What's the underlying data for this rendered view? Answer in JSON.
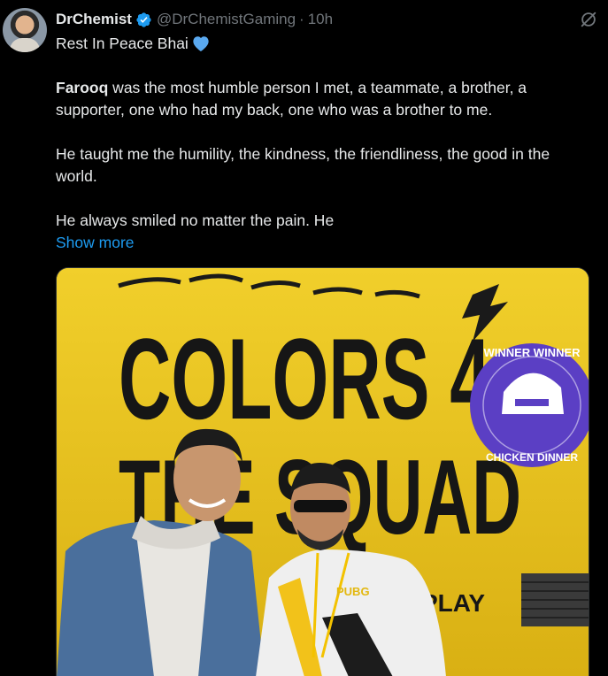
{
  "tweet": {
    "display_name": "DrChemist",
    "handle": "@DrChemistGaming",
    "separator": "·",
    "time": "10h",
    "lines": {
      "l1": "Rest In Peace Bhai",
      "l2_bold": "Farooq",
      "l2_rest": " was the most humble person I met, a teammate, a brother, a",
      "l3": "supporter, one who had my back, one who was a brother to me.",
      "l4": "He taught me the humility, the kindness, the friendliness, the good in the",
      "l5": "world.",
      "l6": "He always smiled no matter the pain. He"
    },
    "show_more": "Show more"
  },
  "media": {
    "truck_text_line1": "COLORS 4",
    "truck_text_line2": "THE SQUAD",
    "badge_text_top": "WINNER WINNER",
    "badge_text_bottom": "CHICKEN DINNER",
    "play_text": "PLAY",
    "shirt_text": "PUBG"
  },
  "colors": {
    "accent": "#1d9bf0",
    "background": "#000000",
    "text": "#e7e9ea",
    "muted": "#71767b",
    "truck_yellow": "#e9c21a",
    "badge_purple": "#5b3fc4"
  },
  "icons": {
    "verified": "verified-badge-icon",
    "heart": "blue-heart-icon",
    "grok": "grok-icon"
  }
}
